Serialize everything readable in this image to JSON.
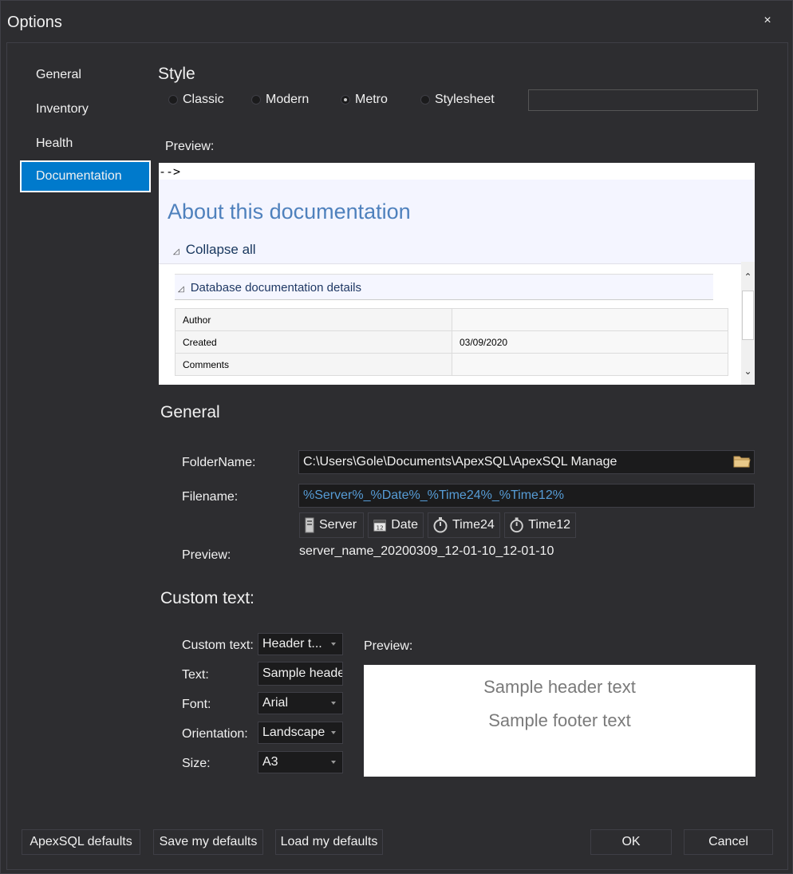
{
  "window": {
    "title": "Options",
    "close_glyph": "×"
  },
  "nav": {
    "items": [
      {
        "label": "General"
      },
      {
        "label": "Inventory"
      },
      {
        "label": "Health"
      },
      {
        "label": "Documentation",
        "active": true
      }
    ]
  },
  "style": {
    "heading": "Style",
    "options": [
      {
        "label": "Classic",
        "checked": false
      },
      {
        "label": "Modern",
        "checked": false
      },
      {
        "label": "Metro",
        "checked": true
      },
      {
        "label": "Stylesheet",
        "checked": false
      }
    ],
    "stylesheet_path": ""
  },
  "preview": {
    "label": "Preview:",
    "comment": "-->",
    "title": "About this documentation",
    "collapse_all": "Collapse all",
    "section": "Database documentation details",
    "rows": [
      {
        "key": "Author",
        "value": ""
      },
      {
        "key": "Created",
        "value": "03/09/2020"
      },
      {
        "key": "Comments",
        "value": ""
      }
    ],
    "scroll_up": "⌃",
    "scroll_down": "⌄"
  },
  "general": {
    "heading": "General",
    "folder_label": "FolderName:",
    "folder_value": "C:\\Users\\Gole\\Documents\\ApexSQL\\ApexSQL Manage",
    "filename_label": "Filename:",
    "filename_value": "%Server%_%Date%_%Time24%_%Time12%",
    "tokens": [
      {
        "label": "Server",
        "icon": "server-icon"
      },
      {
        "label": "Date",
        "icon": "calendar-icon"
      },
      {
        "label": "Time24",
        "icon": "stopwatch-icon"
      },
      {
        "label": "Time12",
        "icon": "stopwatch-icon"
      }
    ],
    "preview_label": "Preview:",
    "preview_value": "server_name_20200309_12-01-10_12-01-10"
  },
  "custom": {
    "heading": "Custom text:",
    "custom_text_label": "Custom text:",
    "custom_text_value": "Header t...",
    "text_label": "Text:",
    "text_value": "Sample header text",
    "font_label": "Font:",
    "font_value": "Arial",
    "orientation_label": "Orientation:",
    "orientation_value": "Landscape",
    "size_label": "Size:",
    "size_value": "A3",
    "preview_label": "Preview:",
    "preview_header": "Sample header text",
    "preview_footer": "Sample footer text"
  },
  "buttons": {
    "apexsql_defaults": "ApexSQL defaults",
    "save_defaults": "Save my defaults",
    "load_defaults": "Load my defaults",
    "ok": "OK",
    "cancel": "Cancel"
  },
  "colors": {
    "background": "#2d2d30",
    "accent": "#007acc",
    "filename_blue": "#569cd6",
    "doc_title_blue": "#4f81bd"
  }
}
